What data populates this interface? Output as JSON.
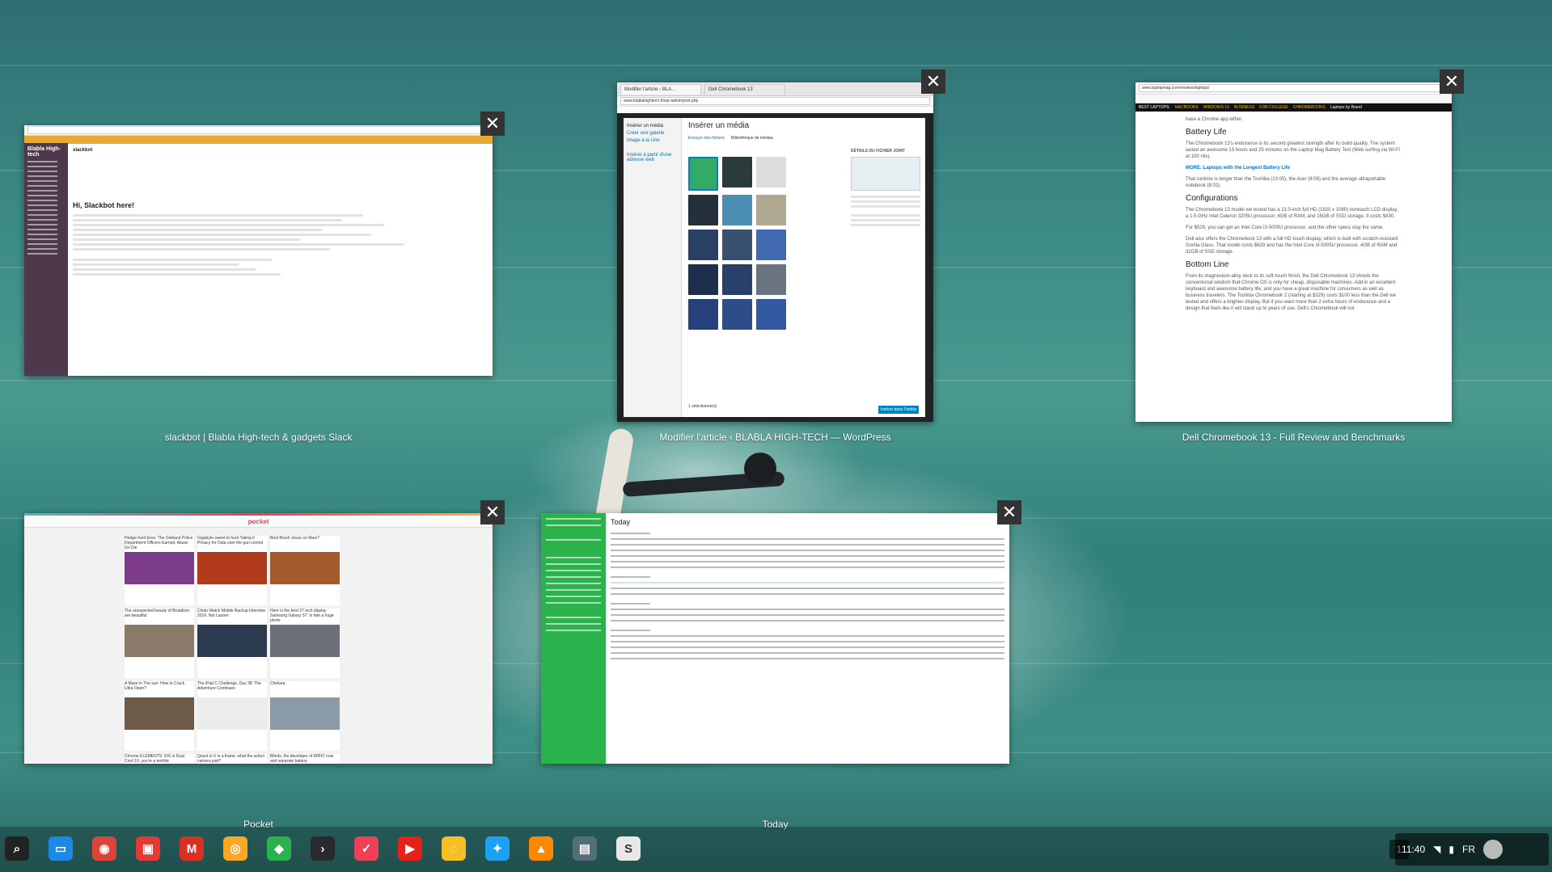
{
  "windows": {
    "slack": {
      "title": "slackbot | Blabla High-tech & gadgets Slack",
      "workspace": "Blabla High-tech",
      "channel": "slackbot",
      "heading": "Hi, Slackbot here!"
    },
    "wordpress": {
      "title": "Modifier l'article ‹ BLABLA HIGH-TECH — WordPress",
      "tab1": "Modifier l'article ‹ BLA...",
      "tab2": "Dell Chromebook 13",
      "url": "www.blablahightech.fr/wp-admin/post.php",
      "modal_title": "Insérer un média",
      "menu": [
        "Insérer un média",
        "Créer une galerie",
        "Image à la Une",
        "Insérer à partir d'une adresse web"
      ],
      "tab_upload": "Envoyer des fichiers",
      "tab_library": "Bibliothèque de médias",
      "details_heading": "DÉTAILS DU FICHIER JOINT",
      "insert_button": "Insérer dans l'article",
      "selected": "1 sélectionné(s)"
    },
    "dell": {
      "title": "Dell Chromebook 13 - Full Review and Benchmarks",
      "url": "www.laptopmag.com/reviews/laptops/",
      "nav": [
        "BEST LAPTOPS:",
        "MACBOOKS",
        "WINDOWS 10",
        "BUSINESS",
        "FOR COLLEGE",
        "CHROMEBOOKS",
        "Laptops by Brand"
      ],
      "intro": "have a Chrome app either.",
      "h_battery": "Battery Life",
      "p_battery": "The Chromebook 13's endurance is its second greatest strength after its build quality. The system lasted an awesome 13 hours and 25 minutes on the Laptop Mag Battery Test (Web surfing via Wi-Fi at 100 nits).",
      "more_label": "MORE:",
      "more_link": "Laptops with the Longest Battery Life",
      "p_runtime": "That runtime is longer than the Toshiba (10:05), the Acer (8:08) and the average ultraportable notebook (8:02).",
      "h_config": "Configurations",
      "p_config": "The Chromebook 13 model we tested has a 13.3-inch full HD (1920 x 1080) nontouch LCD display, a 1.5-GHz Intel Celeron 3205U processor, 4GB of RAM, and 16GB of SSD storage. It costs $430.",
      "p_price": "For $529, you can get an Intel Core i3-5005U processor, and the other specs stay the same.",
      "p_touch": "Dell also offers the Chromebook 13 with a full HD touch display, which is built with scratch-resistant Gorilla Glass. That model costs $629 and has the Intel Core i3-5005U processor, 4GB of RAM and 32GB of SSD storage.",
      "h_bottom": "Bottom Line",
      "p_bottom": "From its magnesium-alloy deck to its soft-touch finish, the Dell Chromebook 13 shreds the conventional wisdom that Chrome OS is only for cheap, disposable machines. Add in an excellent keyboard and awesome battery life, and you have a great machine for consumers as well as business travelers. The Toshiba Chromebook 2 (starting at $329) costs $100 less than the Dell we tested and offers a brighter display. But if you want more than 2 extra hours of endurance and a design that feels like it will stand up to years of use, Dell's Chromebook will not"
    },
    "pocket": {
      "title": "Pocket",
      "logo": "pocket",
      "cards": [
        "Hedge-fund boss: The Oakland Police Department Officers Earned, Abuse Go Die",
        "Gigabyte sweet to hunt Taking it Privacy for Data over the gun control",
        "Best Brush Jesus on Mars?",
        "The unexpected beauty of Brutalism are beautiful",
        "Clean Watch Mobile Backup Interview 2016, Not Lauren",
        "Here is the best 27 inch display Samsung Galaxy S7: Is fate a huge photo",
        "A Maze in The sun: How to Crack Ultra Open?",
        "The iPad C Challenge, Day 38: The Adventure Continues",
        "Chelsea",
        "Chrome ELEMENTS: iOS is Dual Cord 10, you're a terrible",
        "Quest to 5 in a frame: what the action camera part?",
        "Blinds, the developer of WIFIC now and separate battery"
      ]
    },
    "today": {
      "title": "Today",
      "heading": "Today"
    }
  },
  "shelf": {
    "apps": [
      {
        "name": "search",
        "glyph": "⌕",
        "color": "#222222"
      },
      {
        "name": "files",
        "glyph": "▭",
        "color": "#1e88e5"
      },
      {
        "name": "chrome",
        "glyph": "◉",
        "color": "#db4437"
      },
      {
        "name": "photos",
        "glyph": "▣",
        "color": "#e53935"
      },
      {
        "name": "gmail",
        "glyph": "M",
        "color": "#d93025"
      },
      {
        "name": "chrome-canary",
        "glyph": "◎",
        "color": "#f9a825"
      },
      {
        "name": "feedly",
        "glyph": "◆",
        "color": "#2bb24c"
      },
      {
        "name": "plex",
        "glyph": "›",
        "color": "#282a2d"
      },
      {
        "name": "pocket",
        "glyph": "✓",
        "color": "#ef4056"
      },
      {
        "name": "youtube",
        "glyph": "▶",
        "color": "#e62117"
      },
      {
        "name": "keep",
        "glyph": "◌",
        "color": "#f6bf26"
      },
      {
        "name": "twitter",
        "glyph": "✦",
        "color": "#1da1f2"
      },
      {
        "name": "vlc",
        "glyph": "▲",
        "color": "#ff8800"
      },
      {
        "name": "chrome-remote",
        "glyph": "▤",
        "color": "#546e7a"
      },
      {
        "name": "slack",
        "glyph": "S",
        "color": "#e8e8e8"
      }
    ],
    "workspace": "1",
    "time": "11:40",
    "lang": "FR"
  }
}
